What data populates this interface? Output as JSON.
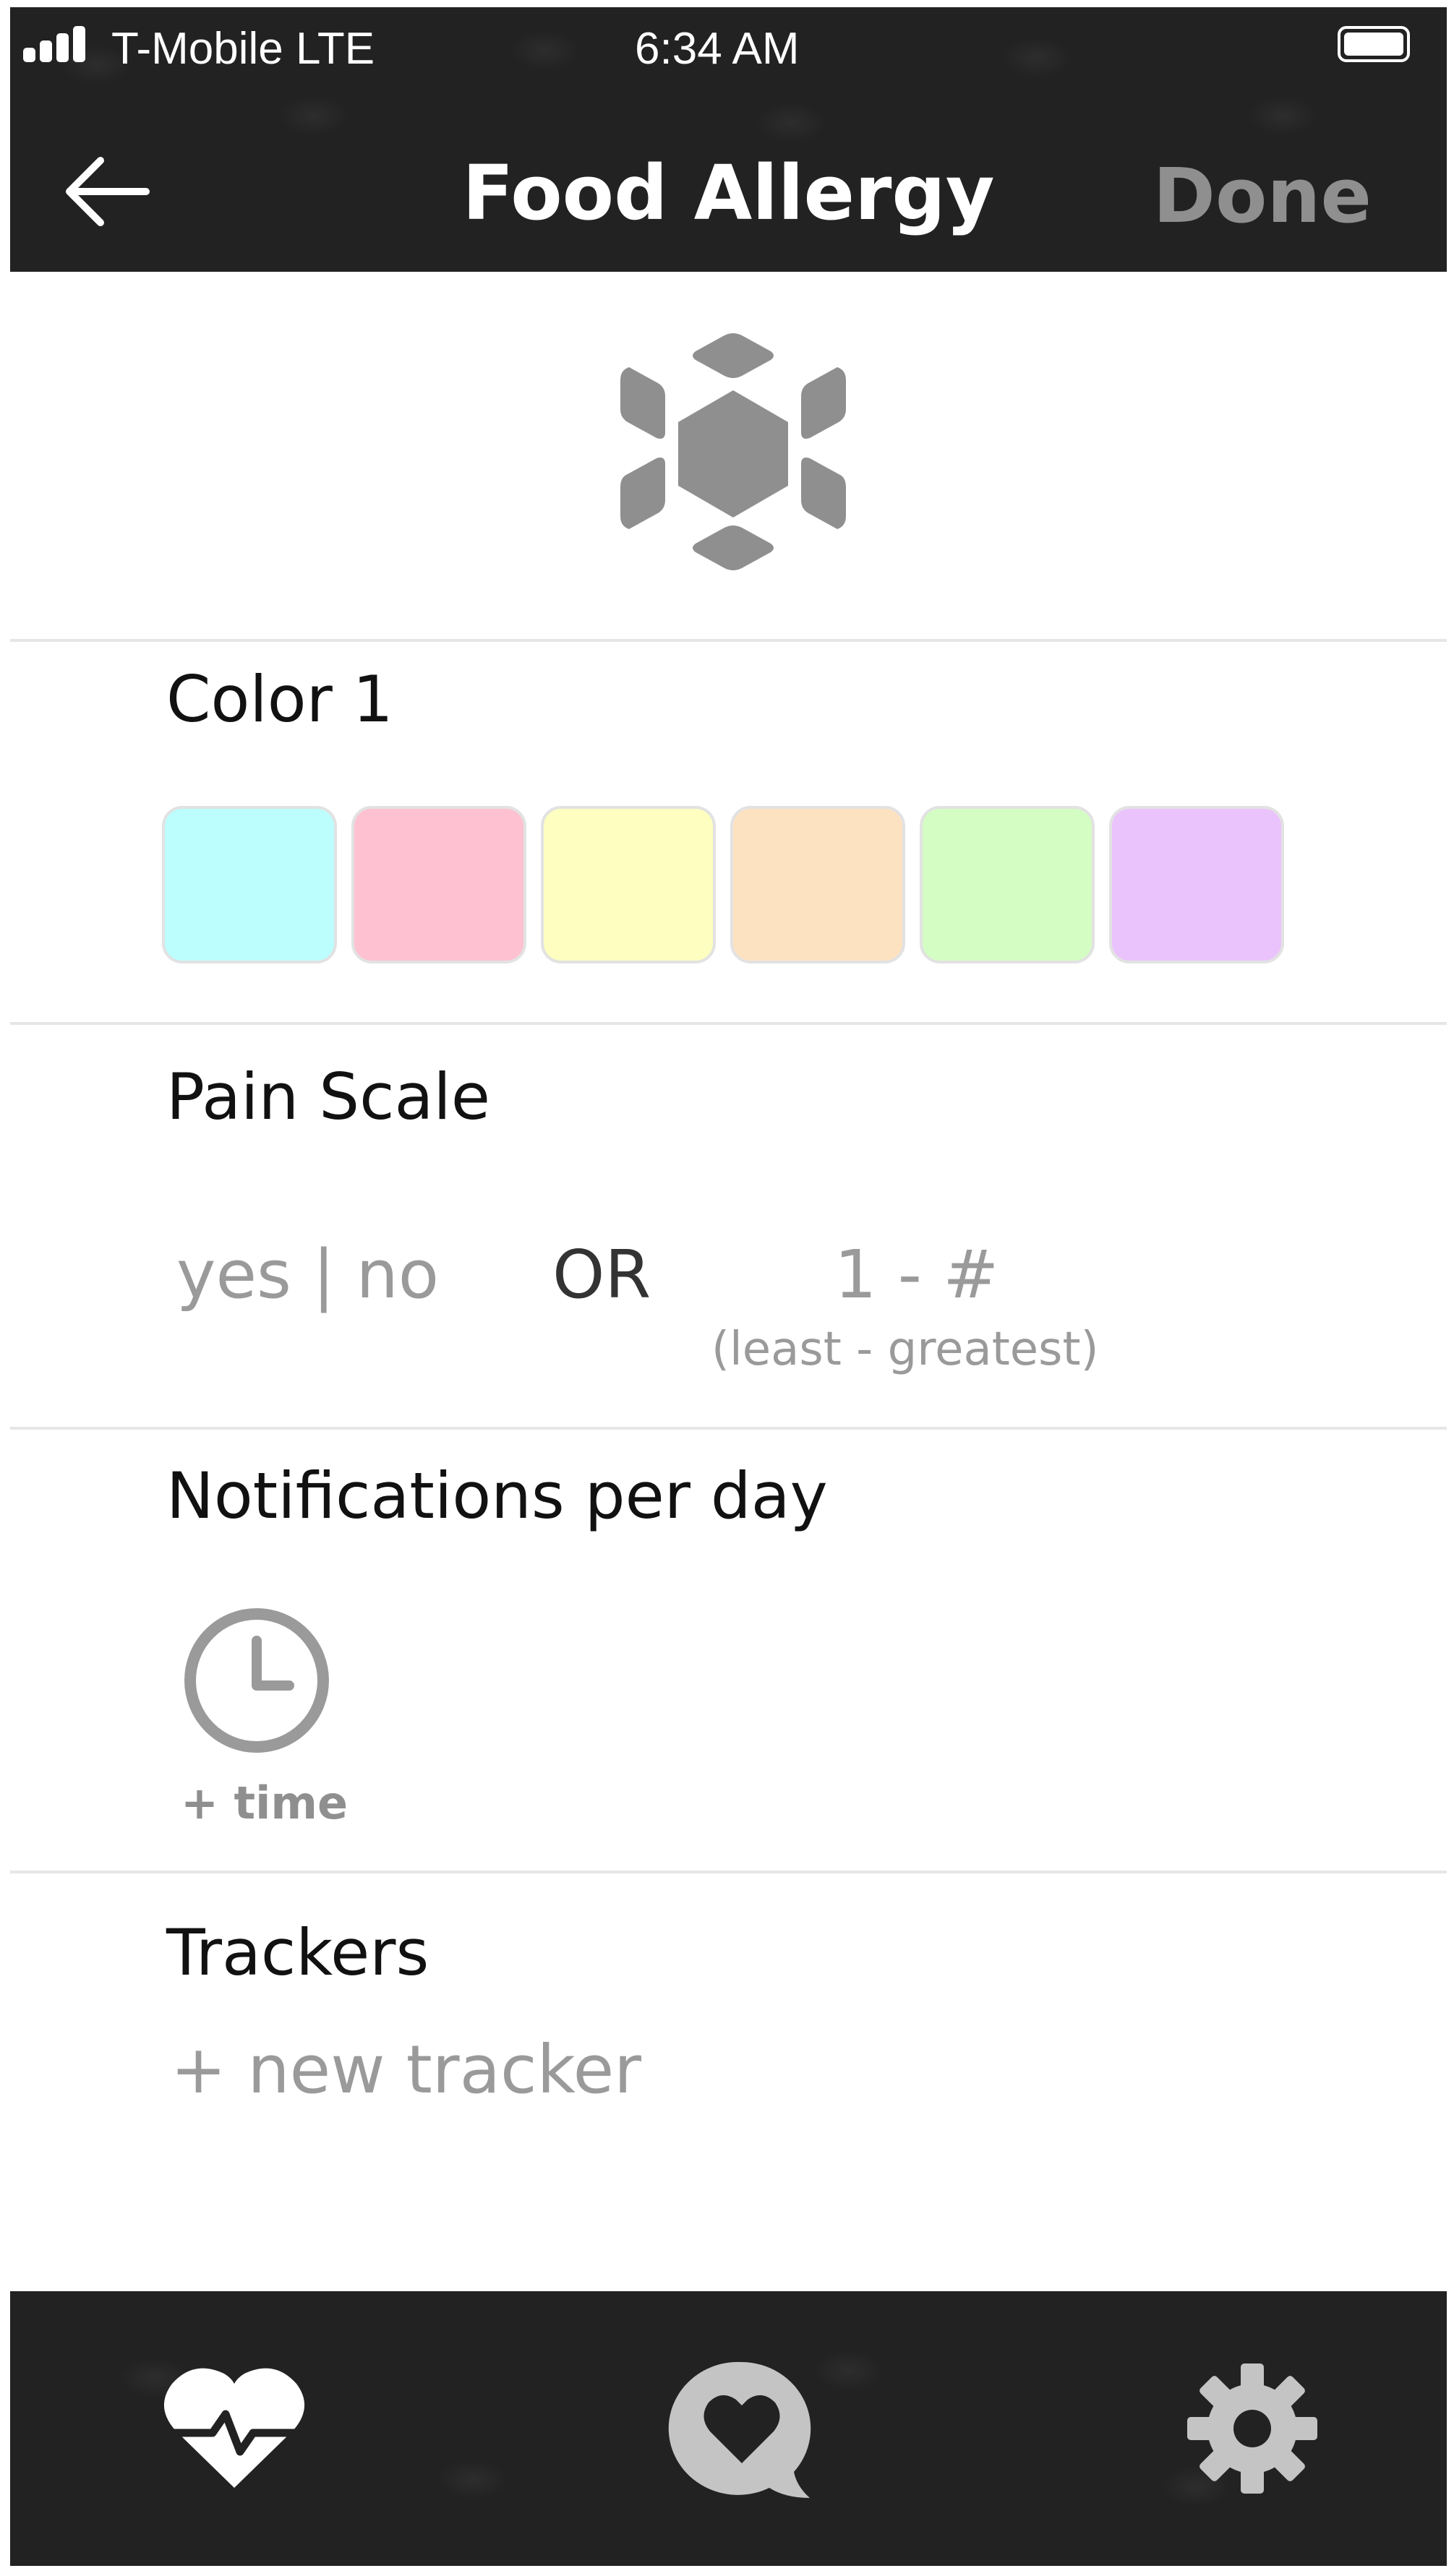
{
  "status_bar": {
    "carrier": "T-Mobile  LTE",
    "time": "6:34 AM"
  },
  "nav": {
    "back_icon": "arrow-left-icon",
    "title": "Food Allergy",
    "done_label": "Done"
  },
  "logo": {
    "icon": "hexagon-cluster-logo"
  },
  "color_section": {
    "title": "Color 1",
    "swatches": [
      "#bcfdfd",
      "#fec1d1",
      "#fdfebf",
      "#fde2c1",
      "#d4fdc3",
      "#ebc3fc"
    ]
  },
  "pain_section": {
    "title": "Pain Scale",
    "yes_no": "yes | no",
    "or_label": "OR",
    "range_label": "1 - #",
    "range_sub": "(least - greatest)"
  },
  "notifications_section": {
    "title": "Notifications per day",
    "icon": "clock-icon",
    "add_time_label": "+ time"
  },
  "trackers_section": {
    "title": "Trackers",
    "new_tracker_label": "+ new tracker"
  },
  "tab_bar": {
    "tabs": [
      {
        "icon": "heart-pulse-icon"
      },
      {
        "icon": "heart-chat-icon"
      },
      {
        "icon": "gear-icon"
      }
    ]
  },
  "colors": {
    "bar_background": "#222222",
    "muted_text": "#9a9a9a",
    "icon_gray": "#8f8f8f"
  }
}
